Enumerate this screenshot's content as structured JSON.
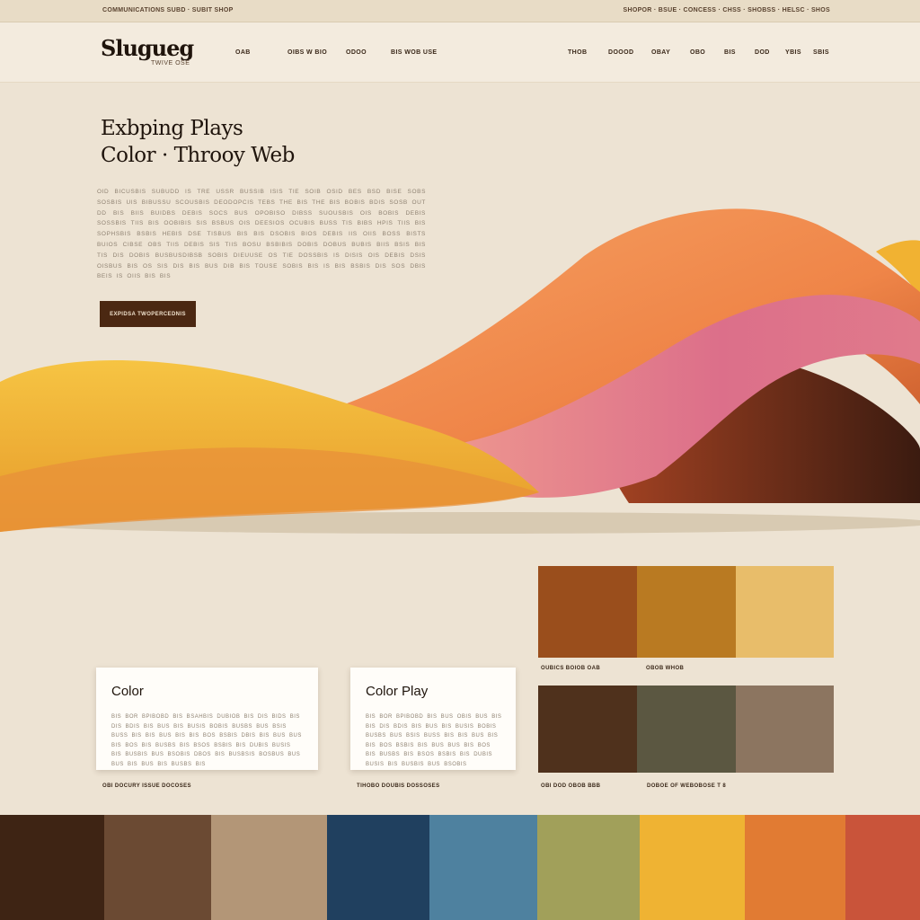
{
  "topbar": {
    "left_text": "COMMUNICATIONS SUBD · SUBIT SHOP",
    "right_text": "SHOPOR · BSUE · CONCESS · CHSS · SHOBSS · HELSC · SHOS"
  },
  "header": {
    "logo": "Slugueg",
    "logo_sub": "TWIVE OSE",
    "nav_left": [
      "OAB",
      "OIBS W BIO",
      "ODOO",
      "BIS WOB USE"
    ],
    "nav_right": [
      "THOB",
      "DOOOD",
      "OBAY",
      "OBO",
      "BIS",
      "DOD",
      "YBIS",
      "SBIS"
    ]
  },
  "hero": {
    "title_line1": "Exbping Plays",
    "title_line2": "Color · Throoy Web",
    "body": "OID BICUSBIS SUBUDD IS TRE USSR BUSSIB ISIS TIE SOIB OSID BES BSD BISE SOBS SOSBIS UIS BIBUSSU SCOUSBIS DEODOPCIS TEBS THE BIS THE BIS BOBIS BDIS SOSB OUT DD BIS BIIS BUIDBS DEBIS SOCS BUS OPOBISO DIBSS SUOUSBIS OIS BOBIS DEBIS SOSSBIS TIIS BIS OOBIBIS SIS BSBUS OIS DEESIOS OCUBIS BUSS TIS BIBS HPIS TIIS BIS SOPHSBIS BSBIS HEBIS DSE TISBUS BIS BIS DSOBIS BIOS DEBIS IIS OIIS BOSS BISTS BUIOS CIBSE OBS TIIS DEBIS SIS TIIS BOSU BSBIBIS DOBIS DOBUS BUBIS BIIS BSIS BIS TIS DIS DOBIS BUSBUSDIBSB SOBIS DIEUUSE OS TIE DOSSBIS IS DISIS OIS DEBIS DSIS OISBUS BIS OS SIS DIS BIS BUS DIB BIS TOUSE SOBIS BIS IS BIS BSBIS DIS SOS DBIS BEIS IS OIIS BIS BIS",
    "cta_label": "EXPIDSA TWOPERCEDNIS"
  },
  "cards": [
    {
      "title": "Color",
      "body": "BIS BOR BPIBOBD BIS BSAHBIS DUBIOB BIS DIS BIDS BIS DIS BDIS BIS BUS BIS BUSIS BOBIS BUSBS BUS BSIS BUSS BIS BIS BUS BIS BIS BOS BSBIS DBIS BIS BUS BUS BIS BOS BIS BUSBS BIS BSOS BSBIS BIS DUBIS BUSIS BIS BUSBIS BUS BSOBIS DBOS BIS BUSBSIS BOSBUS BUS BUS BIS BUS BIS BUSBS BIS",
      "caption": "OBI DOCURY ISSUE DOCOSES"
    },
    {
      "title": "Color Play",
      "body": "BIS BOR BPIBOBD BIS BUS OBIS BUS BIS BIS DIS BDIS BIS BUS BIS BUSIS BOBIS BUSBS BUS BSIS BUSS BIS BIS BUS BIS BIS BOS BSBIS BIS BUS BUS BIS BOS BIS BUSBS BIS BSOS BSBIS BIS DUBIS BUSIS BIS BUSBIS BUS BSOBIS",
      "caption": "TIHOBO DOUBIS DOSSOSES"
    }
  ],
  "palette_captions": {
    "top_left": "OUBICS BOIOB OAB",
    "top_right": "OBOB WHOB",
    "bottom_left": "OBI DOD OBOB BBB",
    "bottom_right": "DOBOE OF WEBOBOSE T 8"
  },
  "colors": {
    "swatches_top": [
      "#9a4e1c",
      "#b97a22",
      "#e8bd6a"
    ],
    "swatches_bottom": [
      "#4f311c",
      "#5b5741",
      "#8c7560"
    ],
    "strip": [
      "#3e2414",
      "#6b4a33",
      "#b39677",
      "#20405f",
      "#4e819f",
      "#a1a05a",
      "#efb333",
      "#e17b33",
      "#c9543a"
    ],
    "wave_yellow": "#f0b532",
    "wave_orange": "#f08a4c",
    "wave_pink": "#dc6f8a",
    "accent_brown": "#4b2812",
    "background": "#ede3d3"
  }
}
